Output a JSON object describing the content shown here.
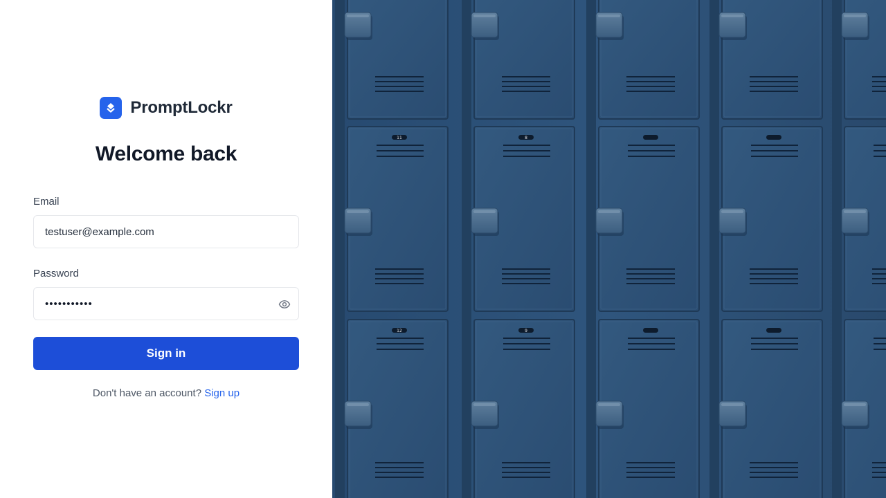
{
  "brand": {
    "name": "PromptLockr",
    "logo_icon": "stack-layers-icon",
    "logo_color": "#2563eb"
  },
  "heading": "Welcome back",
  "form": {
    "email_label": "Email",
    "email_value": "testuser@example.com",
    "password_label": "Password",
    "password_value": "•••••••••••",
    "toggle_icon": "eye-icon",
    "submit_label": "Sign in",
    "submit_color": "#1d4ed8"
  },
  "signup": {
    "prompt": "Don't have an account?",
    "link_label": "Sign up",
    "link_color": "#2563eb"
  },
  "hero": {
    "subject": "blue metal lockers",
    "locker_color": "#2d5178",
    "locker_numbers": [
      "11",
      "8",
      "",
      "",
      "12",
      "9",
      "",
      ""
    ]
  }
}
